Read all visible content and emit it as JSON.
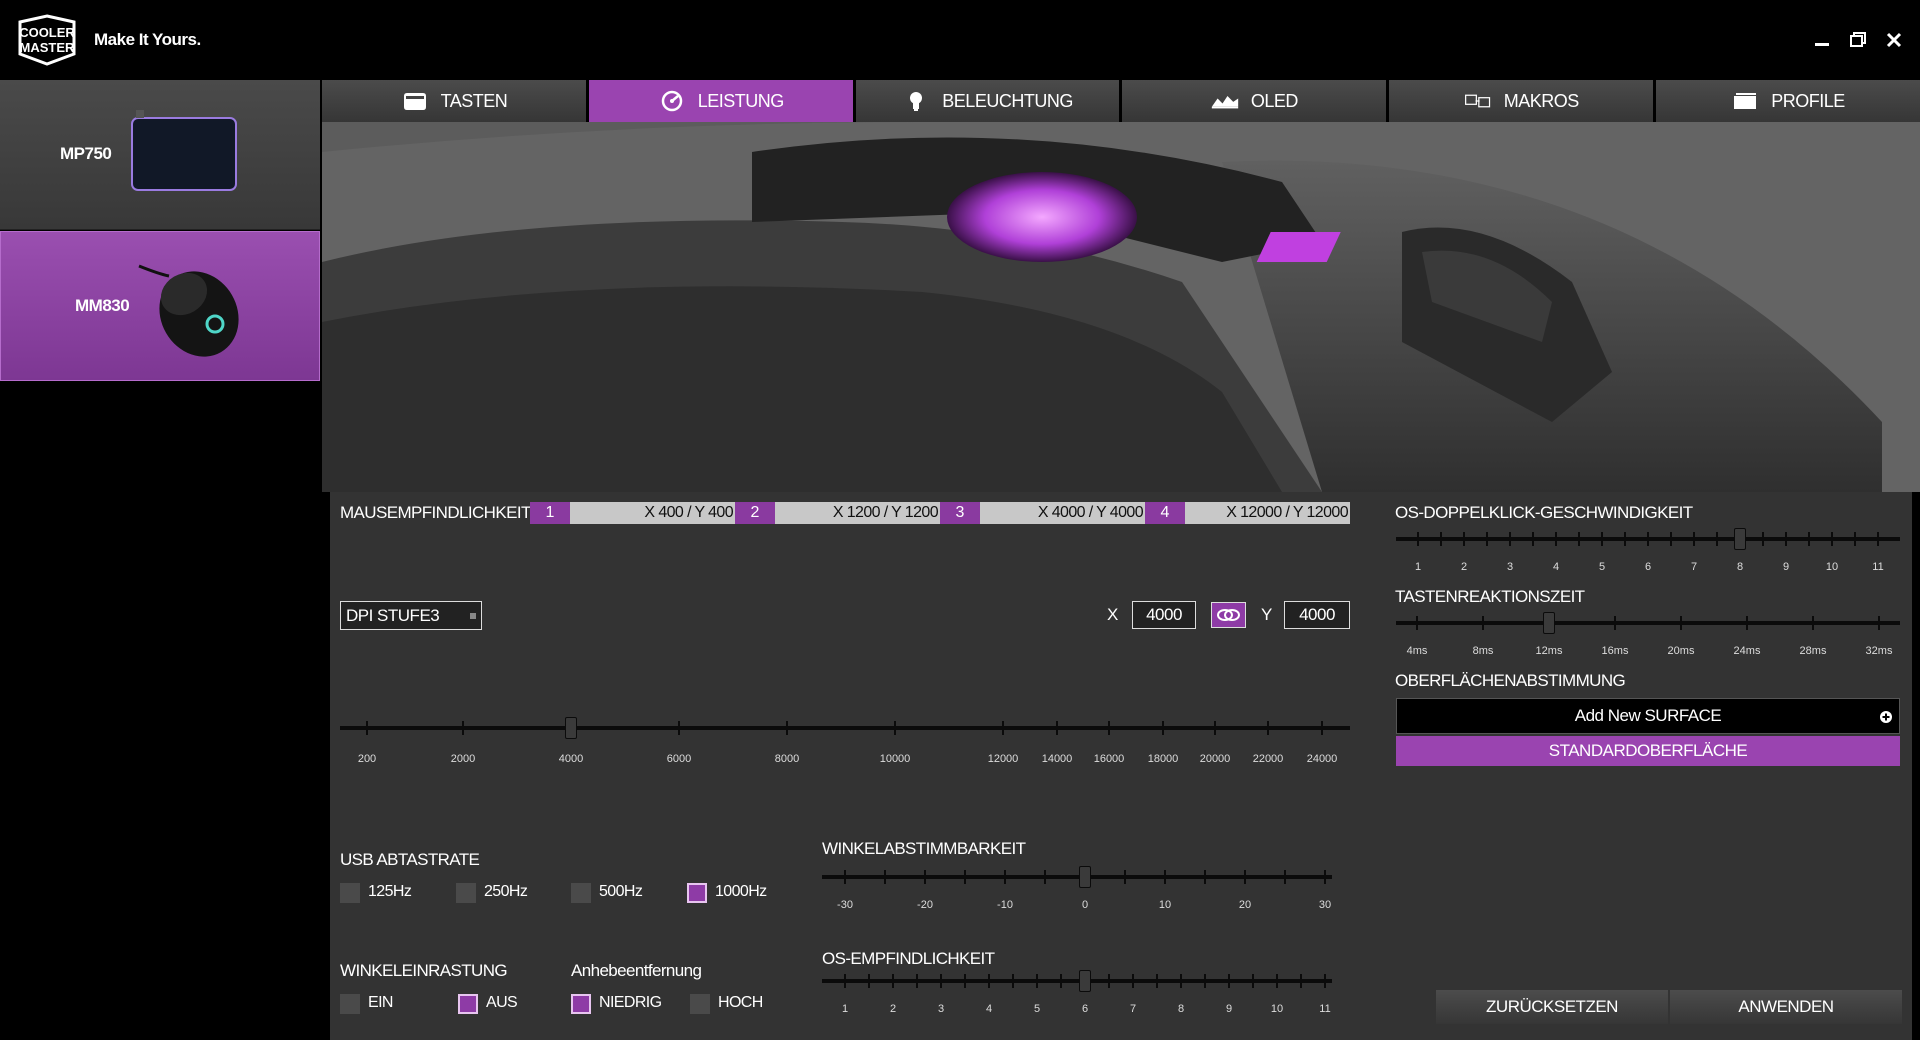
{
  "app": {
    "tagline": "Make It Yours.",
    "logo_text": "COOLER MASTER",
    "window_buttons": [
      "minimize-icon",
      "restore-icon",
      "close-icon"
    ]
  },
  "devices": [
    {
      "label": "MP750",
      "selected": false
    },
    {
      "label": "MM830",
      "selected": true
    }
  ],
  "tabs": [
    {
      "label": "TASTEN",
      "icon": "keyboard-icon",
      "active": false
    },
    {
      "label": "LEISTUNG",
      "icon": "speedometer-icon",
      "active": true
    },
    {
      "label": "BELEUCHTUNG",
      "icon": "lightbulb-icon",
      "active": false
    },
    {
      "label": "OLED",
      "icon": "oled-icon",
      "active": false
    },
    {
      "label": "MAKROS",
      "icon": "macros-icon",
      "active": false
    },
    {
      "label": "PROFILE",
      "icon": "profile-icon",
      "active": false
    }
  ],
  "sensitivity": {
    "title": "MAUSEMPFINDLICHKEIT",
    "stages": [
      {
        "num": "1",
        "value": "X 400 / Y 400"
      },
      {
        "num": "2",
        "value": "X 1200 / Y 1200"
      },
      {
        "num": "3",
        "value": "X 4000 / Y 4000"
      },
      {
        "num": "4",
        "value": "X 12000 / Y 12000"
      }
    ],
    "stage_select": "DPI STUFE3",
    "x_label": "X",
    "x_value": "4000",
    "y_label": "Y",
    "y_value": "4000",
    "slider_value": 4000,
    "ticks": [
      "200",
      "2000",
      "4000",
      "6000",
      "8000",
      "10000",
      "12000",
      "14000",
      "16000",
      "18000",
      "20000",
      "22000",
      "24000"
    ]
  },
  "usb": {
    "title": "USB ABTASTRATE",
    "options": [
      {
        "label": "125Hz",
        "checked": false
      },
      {
        "label": "250Hz",
        "checked": false
      },
      {
        "label": "500Hz",
        "checked": false
      },
      {
        "label": "1000Hz",
        "checked": true
      }
    ]
  },
  "angle_snap": {
    "title": "WINKELEINRASTUNG",
    "options": [
      {
        "label": "EIN",
        "checked": false
      },
      {
        "label": "AUS",
        "checked": true
      }
    ]
  },
  "lift_off": {
    "title": "Anhebeentfernung",
    "options": [
      {
        "label": "NIEDRIG",
        "checked": true
      },
      {
        "label": "HOCH",
        "checked": false
      }
    ]
  },
  "angle_tuning": {
    "title": "WINKELABSTIMMBARKEIT",
    "ticks": [
      "-30",
      "-20",
      "-10",
      "0",
      "10",
      "20",
      "30"
    ],
    "value": 0
  },
  "os_sensitivity": {
    "title": "OS-EMPFINDLICHKEIT",
    "ticks": [
      "1",
      "2",
      "3",
      "4",
      "5",
      "6",
      "7",
      "8",
      "9",
      "10",
      "11"
    ],
    "value": 6
  },
  "double_click": {
    "title": "OS-DOPPELKLICK-GESCHWINDIGKEIT",
    "ticks": [
      "1",
      "2",
      "3",
      "4",
      "5",
      "6",
      "7",
      "8",
      "9",
      "10",
      "11"
    ],
    "value": 8
  },
  "response": {
    "title": "TASTENREAKTIONSZEIT",
    "ticks": [
      "4ms",
      "8ms",
      "12ms",
      "16ms",
      "20ms",
      "24ms",
      "28ms",
      "32ms"
    ],
    "value": "12ms"
  },
  "surface": {
    "title": "OBERFLÄCHENABSTIMMUNG",
    "add_label": "Add New SURFACE",
    "standard_label": "STANDARDOBERFLÄCHE"
  },
  "buttons": {
    "reset": "ZURÜCKSETZEN",
    "apply": "ANWENDEN"
  },
  "colors": {
    "accent": "#9a44b0",
    "panel": "#333333"
  }
}
